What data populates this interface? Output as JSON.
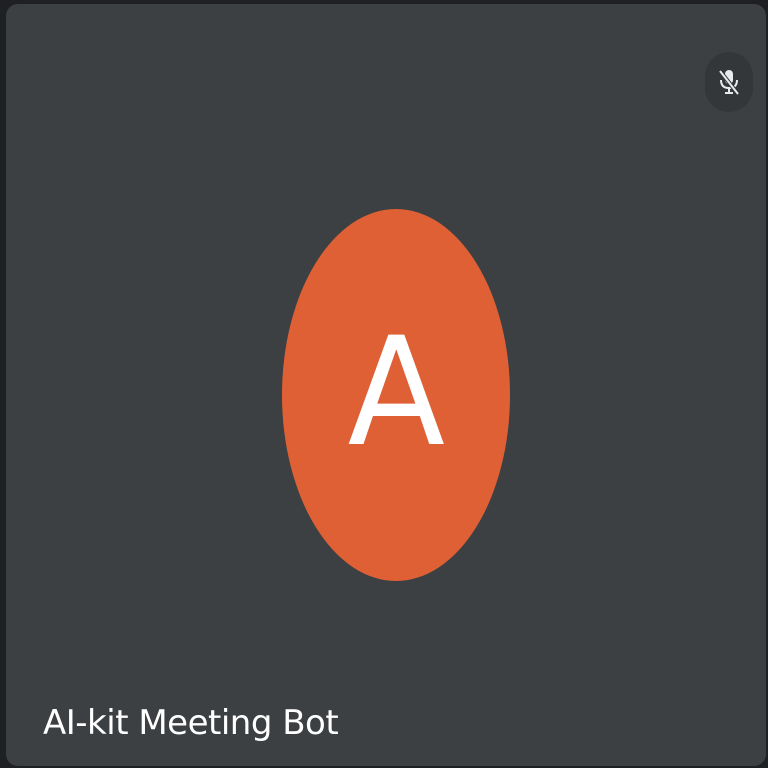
{
  "participant": {
    "name": "AI-kit Meeting Bot",
    "initial": "A",
    "avatar_color": "#e06035",
    "muted": true
  },
  "icons": {
    "mute_indicator": "microphone-off-icon"
  },
  "colors": {
    "tile_background": "#3c4043",
    "page_background": "#1f2023",
    "badge_background": "#33373a",
    "text": "#ffffff"
  }
}
